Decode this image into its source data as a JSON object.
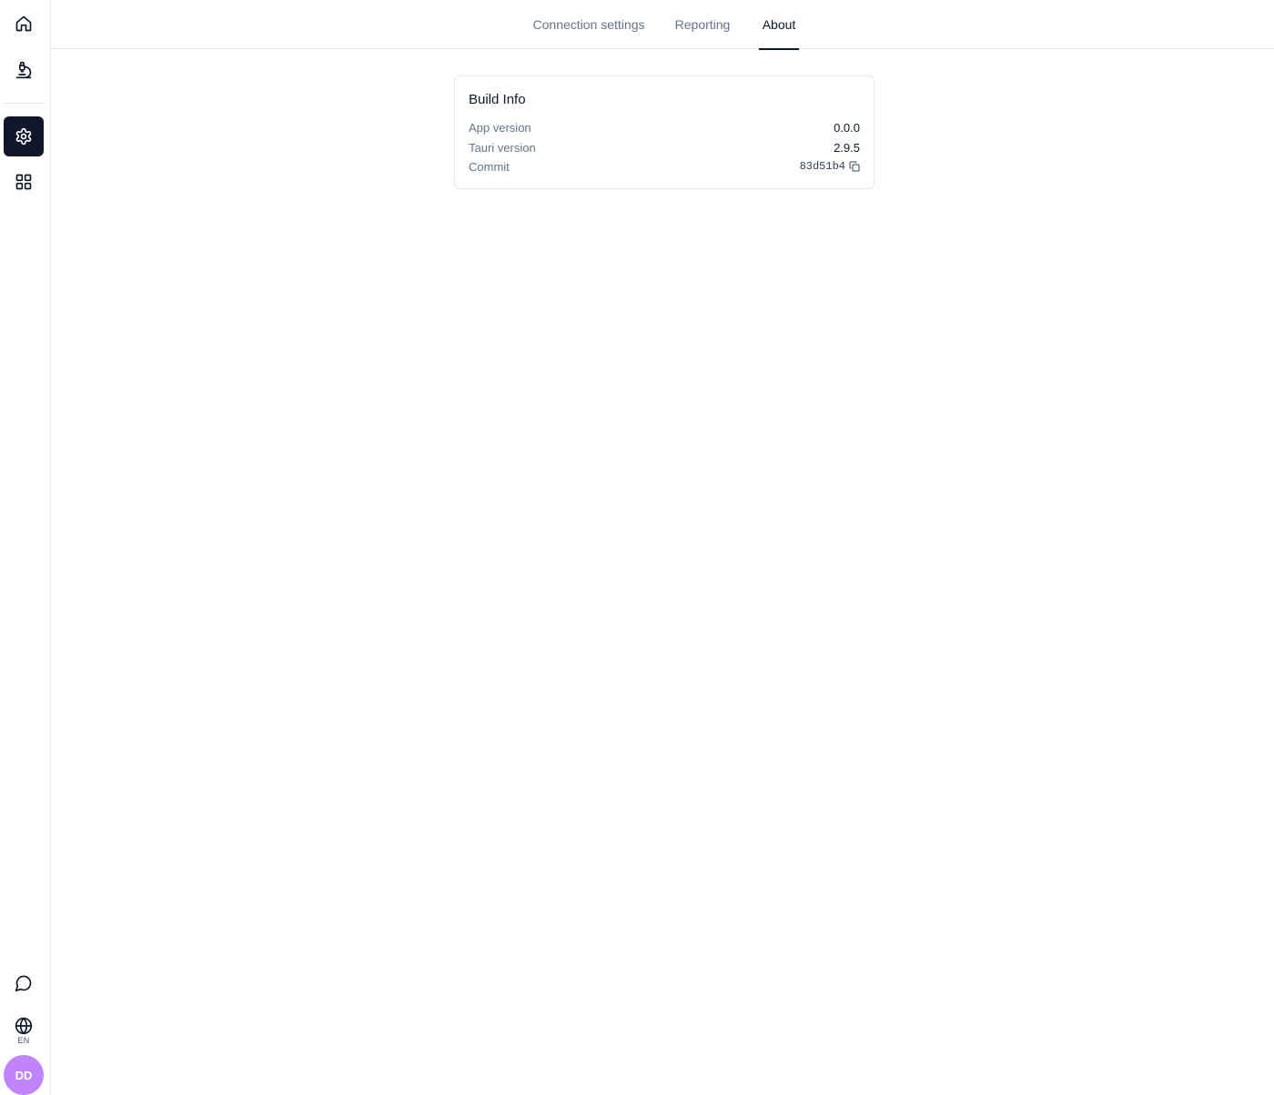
{
  "sidebar": {
    "items": [
      {
        "name": "home",
        "icon": "home-icon"
      },
      {
        "name": "lab",
        "icon": "microscope-icon"
      },
      {
        "name": "settings",
        "icon": "gear-icon",
        "active": true
      },
      {
        "name": "apps",
        "icon": "grid-icon"
      }
    ],
    "feedback_icon": "message-circle-icon",
    "language": {
      "icon": "globe-icon",
      "label": "EN"
    },
    "avatar": {
      "initials": "DD",
      "color": "#c084fc"
    }
  },
  "tabs": [
    {
      "label": "Connection settings",
      "active": false
    },
    {
      "label": "Reporting",
      "active": false
    },
    {
      "label": "About",
      "active": true
    }
  ],
  "build_info": {
    "title": "Build Info",
    "rows": [
      {
        "label": "App version",
        "value": "0.0.0"
      },
      {
        "label": "Tauri version",
        "value": "2.9.5"
      },
      {
        "label": "Commit",
        "value": "83d51b4",
        "copy_icon": "copy-icon"
      }
    ]
  },
  "colors": {
    "accent": "#0f172a",
    "muted_text": "#64748b",
    "border": "#e5e7eb",
    "avatar": "#c084fc"
  }
}
